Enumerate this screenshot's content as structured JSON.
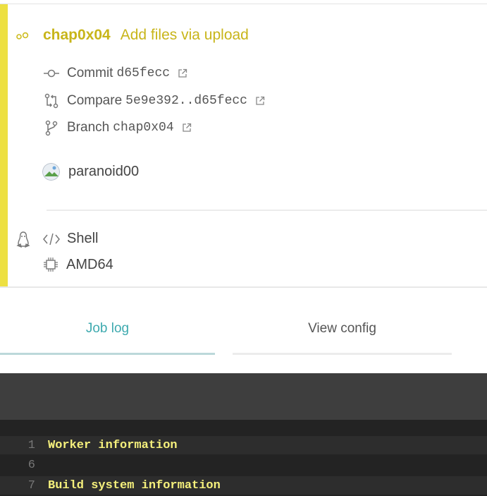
{
  "build": {
    "branch": "chap0x04",
    "commit_message": "Add files via upload",
    "commit_label": "Commit",
    "commit_sha": "d65fecc",
    "compare_label": "Compare",
    "compare_range": "5e9e392..d65fecc",
    "branch_label": "Branch",
    "branch_value": "chap0x04",
    "author": "paranoid00",
    "language": "Shell",
    "arch": "AMD64",
    "status_color": "#ede042"
  },
  "tabs": [
    {
      "label": "Job log",
      "active": true
    },
    {
      "label": "View config",
      "active": false
    }
  ],
  "log": {
    "lines": [
      {
        "number": "1",
        "text": "Worker information"
      },
      {
        "number": "6",
        "text": ""
      },
      {
        "number": "7",
        "text": "Build system information"
      }
    ]
  },
  "icons": {
    "status": "build-status-icon",
    "commit": "commit-icon",
    "compare": "compare-icon",
    "branch": "branch-icon",
    "external": "external-link-icon",
    "os": "linux-icon",
    "language": "code-icon",
    "arch": "cpu-icon"
  }
}
